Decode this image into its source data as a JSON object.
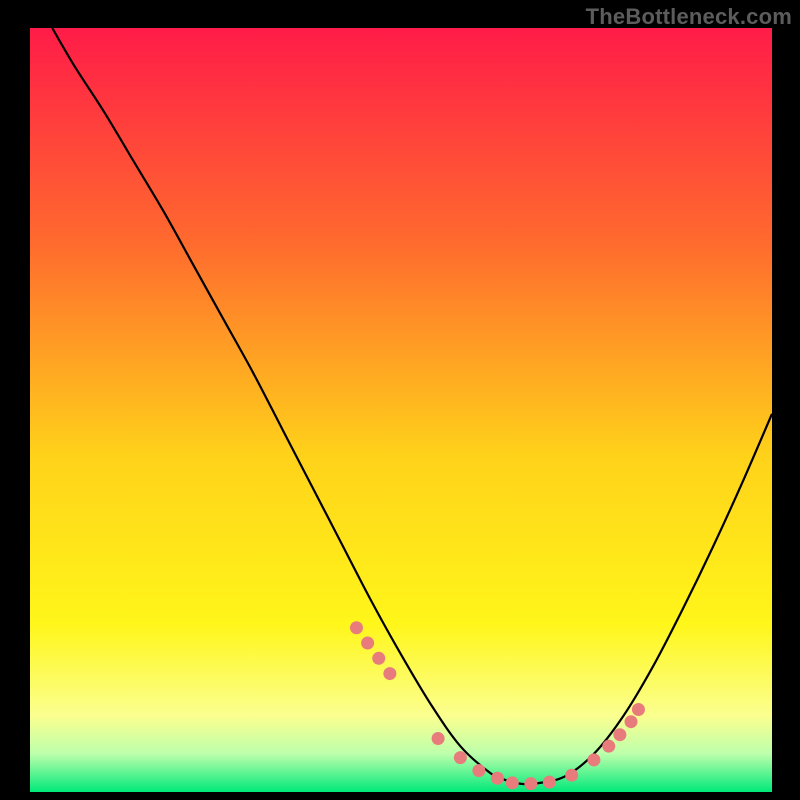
{
  "watermark_text": "TheBottleneck.com",
  "colors": {
    "page_bg": "#000000",
    "gradient_top": "#ff1c48",
    "gradient_mid1": "#ff6a2e",
    "gradient_mid2": "#ffd21a",
    "gradient_mid3": "#fff61a",
    "gradient_green_pale": "#bdffab",
    "gradient_green": "#00e97a",
    "curve_color": "#000000",
    "marker_fill": "#e87c7c",
    "marker_stroke": "#c24545"
  },
  "chart_data": {
    "type": "line",
    "title": "",
    "xlabel": "",
    "ylabel": "",
    "xlim": [
      0,
      100
    ],
    "ylim": [
      0,
      100
    ],
    "series": [
      {
        "name": "bottleneck-curve",
        "x": [
          3,
          6,
          10,
          14,
          18,
          22,
          26,
          30,
          34,
          38,
          42,
          46,
          50,
          54,
          58,
          62,
          64,
          66,
          68,
          72,
          76,
          80,
          84,
          88,
          92,
          96,
          100
        ],
        "y": [
          100,
          95,
          89,
          82.5,
          76,
          69,
          62,
          55,
          47.5,
          40,
          32.5,
          25,
          18,
          11.5,
          6,
          2.5,
          1.6,
          1.1,
          1.1,
          2,
          5,
          10,
          16.5,
          24,
          32,
          40.5,
          49.5
        ]
      }
    ],
    "markers": {
      "name": "highlight-points",
      "x": [
        44,
        45.5,
        47,
        48.5,
        55,
        58,
        60.5,
        63,
        65,
        67.5,
        70,
        73,
        76,
        78,
        79.5,
        81,
        82
      ],
      "y": [
        21.5,
        19.5,
        17.5,
        15.5,
        7,
        4.5,
        2.8,
        1.8,
        1.2,
        1.1,
        1.3,
        2.2,
        4.2,
        6,
        7.5,
        9.2,
        10.8
      ]
    }
  }
}
